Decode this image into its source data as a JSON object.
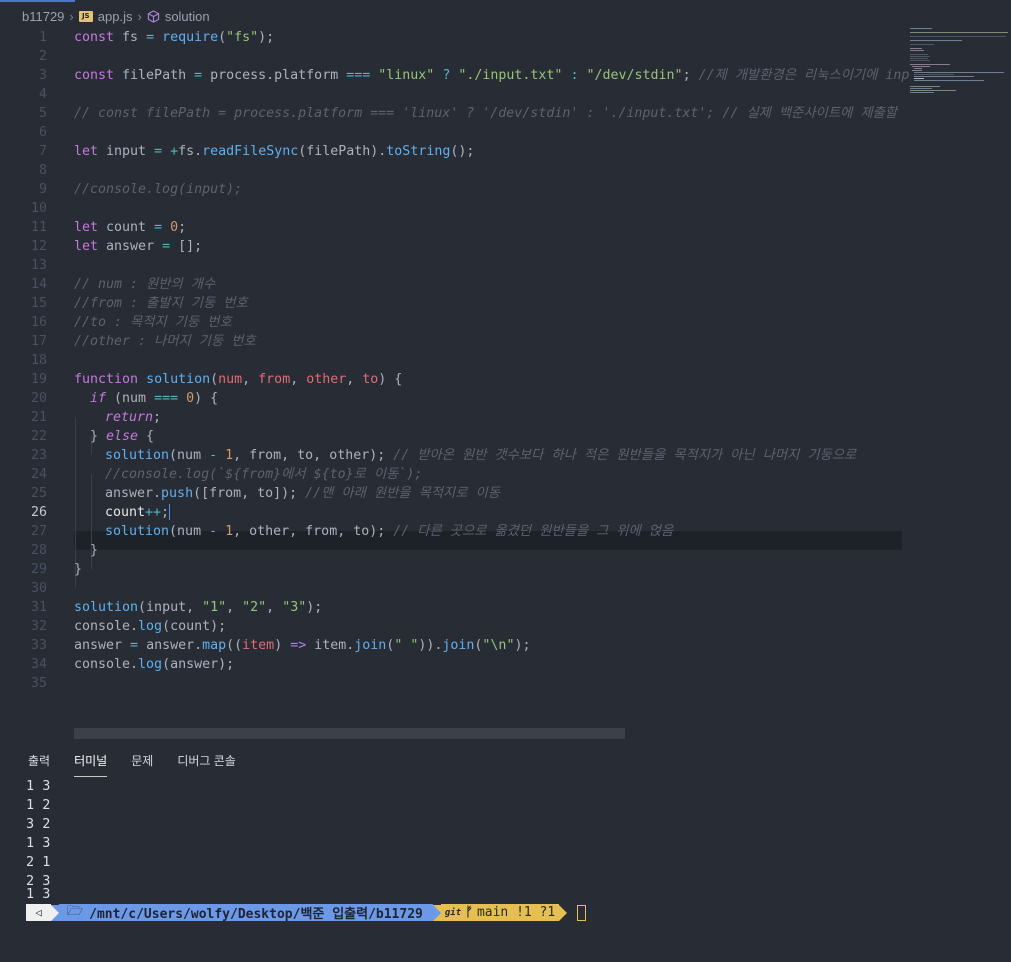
{
  "breadcrumb": {
    "folder": "b11729",
    "file": "app.js",
    "file_icon": "JS",
    "symbol": "solution"
  },
  "editor": {
    "active_line": 26,
    "lines": [
      {
        "n": "1"
      },
      {
        "n": "2"
      },
      {
        "n": "3"
      },
      {
        "n": "4"
      },
      {
        "n": "5"
      },
      {
        "n": "6"
      },
      {
        "n": "7"
      },
      {
        "n": "8"
      },
      {
        "n": "9"
      },
      {
        "n": "10"
      },
      {
        "n": "11"
      },
      {
        "n": "12"
      },
      {
        "n": "13"
      },
      {
        "n": "14"
      },
      {
        "n": "15"
      },
      {
        "n": "16"
      },
      {
        "n": "17"
      },
      {
        "n": "18"
      },
      {
        "n": "19"
      },
      {
        "n": "20"
      },
      {
        "n": "21"
      },
      {
        "n": "22"
      },
      {
        "n": "23"
      },
      {
        "n": "24"
      },
      {
        "n": "25"
      },
      {
        "n": "26"
      },
      {
        "n": "27"
      },
      {
        "n": "28"
      },
      {
        "n": "29"
      },
      {
        "n": "30"
      },
      {
        "n": "31"
      },
      {
        "n": "32"
      },
      {
        "n": "33"
      },
      {
        "n": "34"
      },
      {
        "n": "35"
      }
    ],
    "code": {
      "l1": [
        "const",
        " fs ",
        "=",
        " require",
        "(",
        "\"fs\"",
        ");"
      ],
      "l3": [
        "const",
        " filePath ",
        "=",
        " process.platform ",
        "===",
        " ",
        "\"linux\"",
        " ",
        "?",
        " ",
        "\"./input.txt\"",
        " ",
        ":",
        " ",
        "\"/dev/stdin\"",
        "; ",
        "//제 개발환경은 리눅스이기에 inp"
      ],
      "l5": "// const filePath = process.platform === 'linux' ? '/dev/stdin' : './input.txt'; // 실제 백준사이트에 제출할 ",
      "l7": [
        "let",
        " input ",
        "=",
        " ",
        "+",
        "fs.",
        "readFileSync",
        "(filePath).",
        "toString",
        "();"
      ],
      "l9": "//console.log(input);",
      "l11": [
        "let",
        " count ",
        "=",
        " ",
        "0",
        ";"
      ],
      "l12": [
        "let",
        " answer ",
        "=",
        " [];"
      ],
      "l14": "// num : 원반의 개수",
      "l15": "//from : 출발지 기둥 번호",
      "l16": "//to : 목적지 기둥 번호",
      "l17": "//other : 나머지 기둥 번호",
      "l19": [
        "function",
        " ",
        "solution",
        "(",
        "num",
        ", ",
        "from",
        ", ",
        "other",
        ", ",
        "to",
        ") {"
      ],
      "l20": [
        "if",
        " (num ",
        "===",
        " ",
        "0",
        ") {"
      ],
      "l21": [
        "return",
        ";"
      ],
      "l22": [
        "} ",
        "else",
        " {"
      ],
      "l23": [
        "solution",
        "(num ",
        "-",
        " ",
        "1",
        ", from, to, other); ",
        "// 받아온 원반 갯수보다 하나 적은 원반들을 목적지가 아닌 나머지 기둥으로"
      ],
      "l24": "//console.log(`${from}에서 ${to}로 이동`);",
      "l25": [
        "answer.",
        "push",
        "([from, to]); ",
        "//맨 아래 원반을 목적지로 이동"
      ],
      "l26": [
        "count",
        "++",
        ";"
      ],
      "l27": [
        "solution",
        "(num ",
        "-",
        " ",
        "1",
        ", other, from, to); ",
        "// 다른 곳으로 옮겼던 원반들을 그 위에 얹음"
      ],
      "l28": "}",
      "l29": "}",
      "l31": [
        "solution",
        "(input, ",
        "\"1\"",
        ", ",
        "\"2\"",
        ", ",
        "\"3\"",
        ");"
      ],
      "l32": [
        "console.",
        "log",
        "(count);"
      ],
      "l33": [
        "answer ",
        "=",
        " answer.",
        "map",
        "((",
        "item",
        ") ",
        "=>",
        " item.",
        "join",
        "(",
        "\" \"",
        ")).",
        "join",
        "(",
        "\"\\n\"",
        ");"
      ],
      "l34": [
        "console.",
        "log",
        "(answer);"
      ]
    }
  },
  "panel": {
    "tabs": [
      "출력",
      "터미널",
      "문제",
      "디버그 콘솔"
    ],
    "active_tab": "터미널",
    "terminal_lines": [
      "1 3",
      "1 2",
      "3 2",
      "1 3",
      "2 1",
      "2 3",
      "1 3"
    ]
  },
  "prompt": {
    "os_glyph": "◁",
    "folder_glyph": "🗁",
    "path": "/mnt/c/Users/wolfy/Desktop/백준 입출력/b11729",
    "git_glyph": "git",
    "branch_glyph": "ᚠ",
    "branch": "main !1 ?1"
  },
  "colors": {
    "background": "#272c35",
    "keyword": "#c678dd",
    "function": "#61afef",
    "string": "#98c379",
    "number": "#d19a66",
    "parameter": "#e06c75",
    "operator": "#56b6c2",
    "comment": "#5c6370",
    "prompt_path_bg": "#6c98e8",
    "prompt_git_bg": "#e5bf51"
  }
}
